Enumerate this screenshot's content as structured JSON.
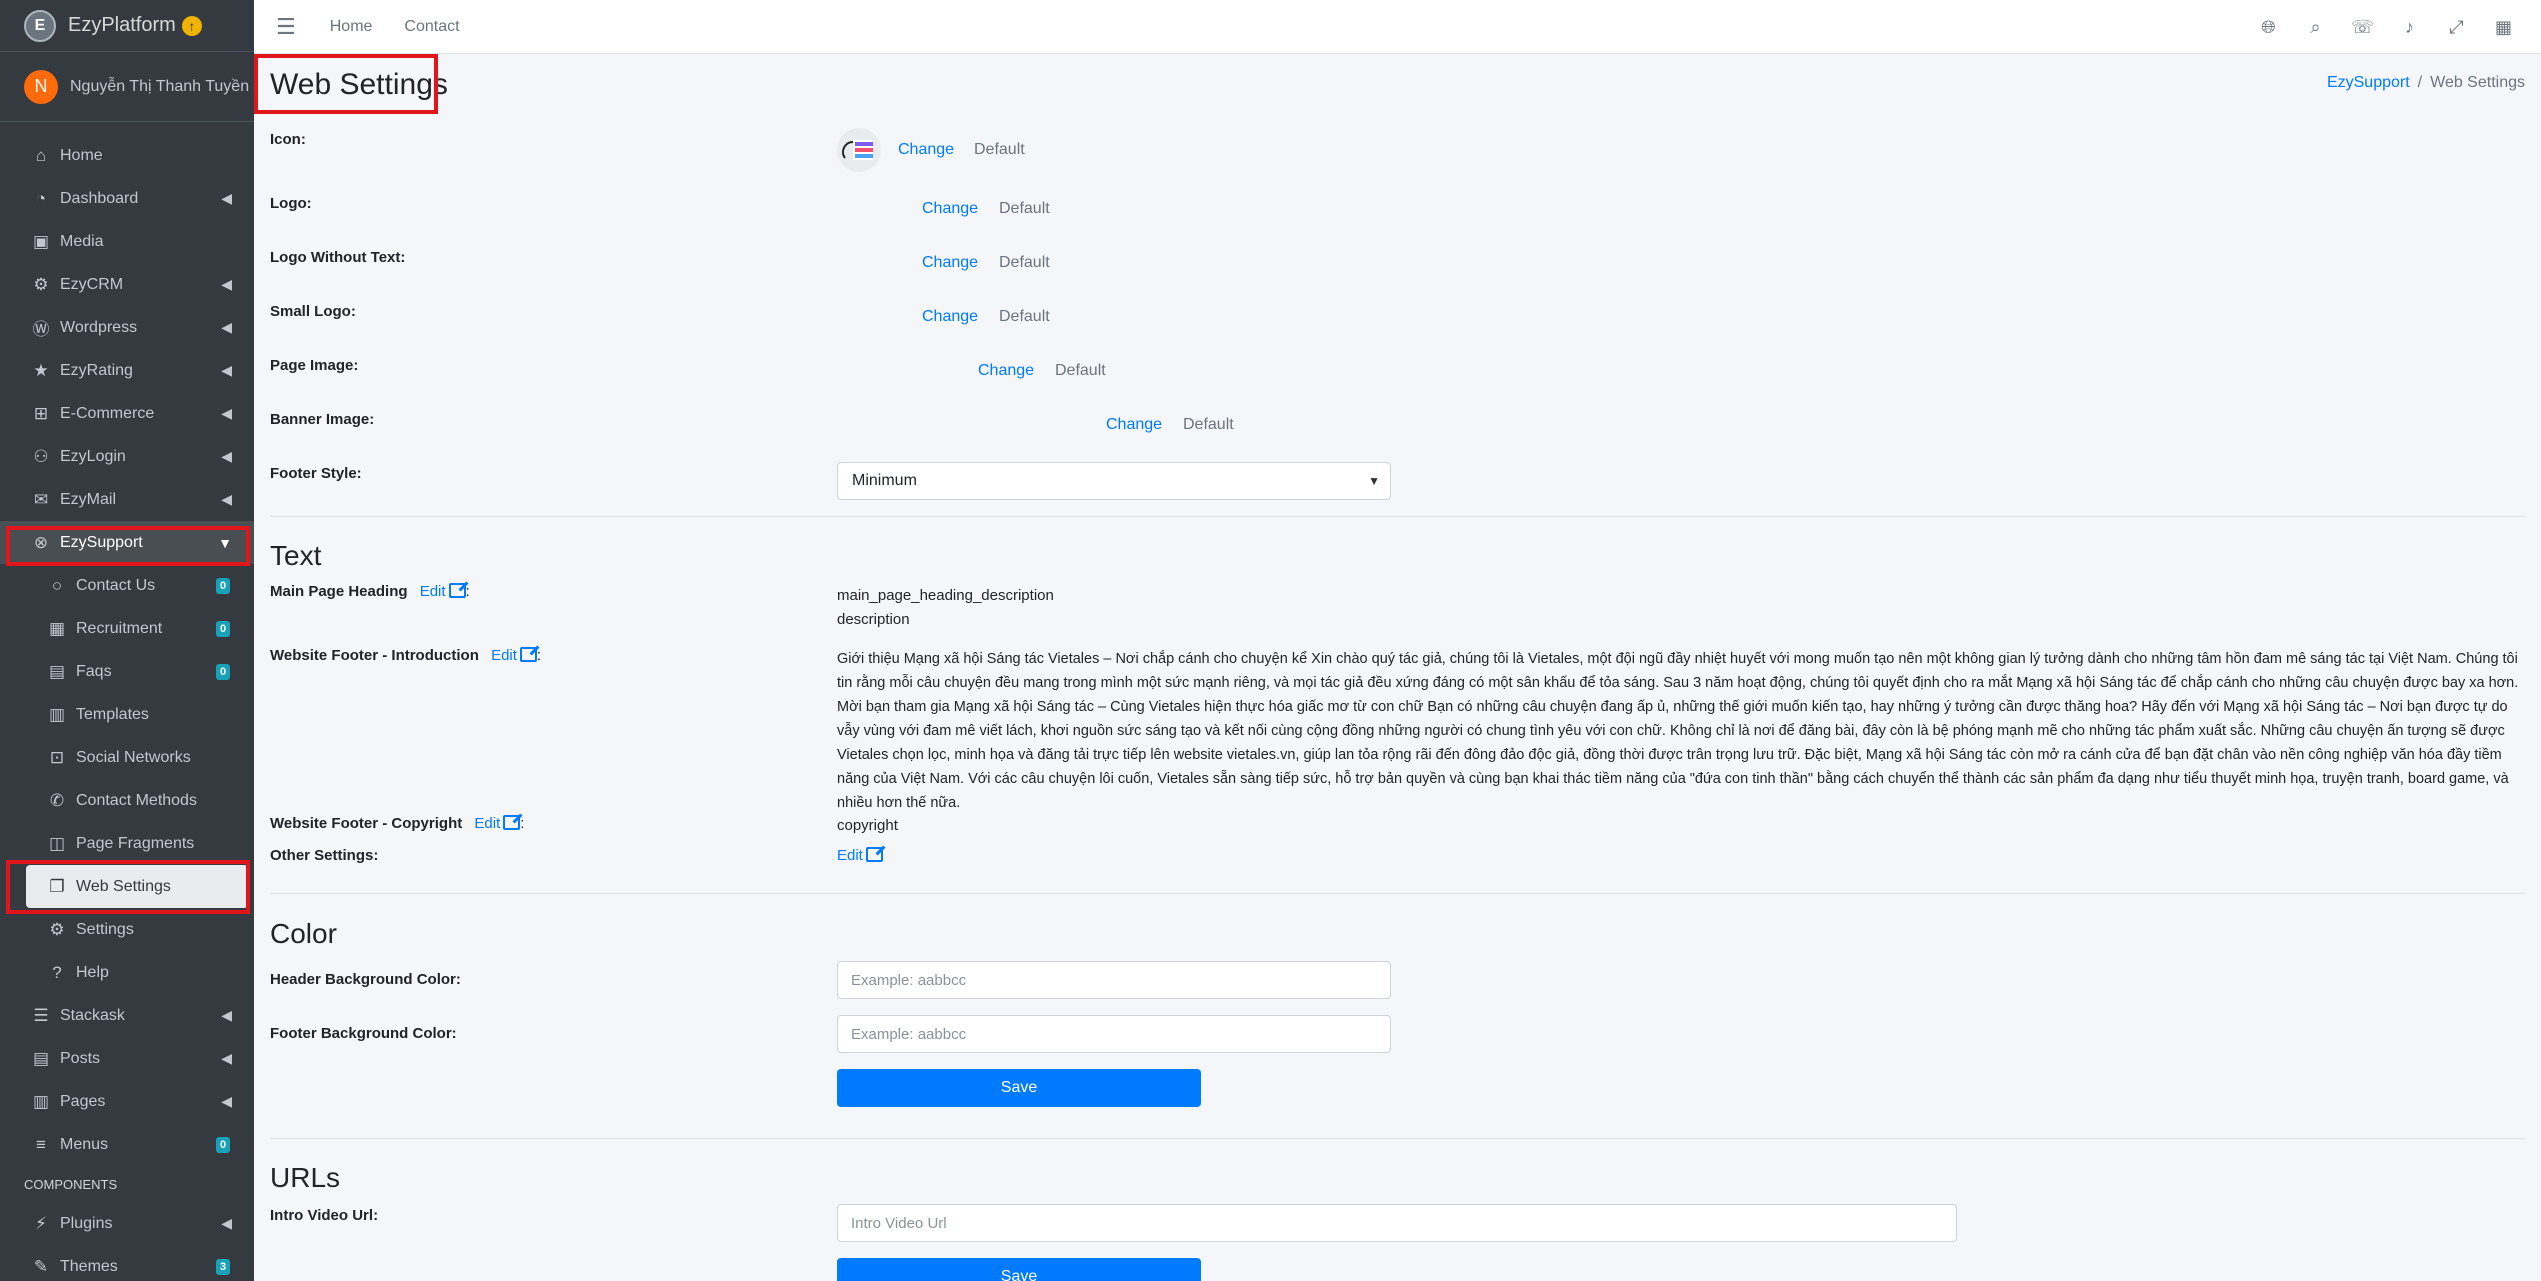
{
  "brand": {
    "name": "EzyPlatform",
    "logo_letter": "E",
    "badge_icon": "arrow-up-circle-icon"
  },
  "user": {
    "initial": "N",
    "name": "Nguyễn Thị Thanh Tuyền"
  },
  "sidebar": {
    "items": [
      {
        "label": "Home",
        "icon": "home-icon"
      },
      {
        "label": "Dashboard",
        "icon": "dashboard-icon"
      },
      {
        "label": "Media",
        "icon": "image-icon"
      },
      {
        "label": "EzyCRM",
        "icon": "crm-icon"
      },
      {
        "label": "Wordpress",
        "icon": "wordpress-icon"
      },
      {
        "label": "EzyRating",
        "icon": "star-icon"
      },
      {
        "label": "E-Commerce",
        "icon": "basket-icon"
      },
      {
        "label": "EzyLogin",
        "icon": "user-lock-icon"
      },
      {
        "label": "EzyMail",
        "icon": "mail-icon"
      },
      {
        "label": "EzySupport",
        "icon": "support-icon"
      }
    ],
    "sub_items": [
      {
        "label": "Contact Us",
        "badge": "0"
      },
      {
        "label": "Recruitment",
        "badge": "0"
      },
      {
        "label": "Faqs",
        "badge": "0"
      },
      {
        "label": "Templates"
      },
      {
        "label": "Social Networks"
      },
      {
        "label": "Contact Methods"
      },
      {
        "label": "Page Fragments"
      },
      {
        "label": "Web Settings"
      },
      {
        "label": "Settings"
      },
      {
        "label": "Help"
      }
    ],
    "more_items": [
      {
        "label": "Stackask"
      },
      {
        "label": "Posts"
      },
      {
        "label": "Pages"
      },
      {
        "label": "Menus",
        "badge": "0"
      }
    ],
    "components_header": "COMPONENTS",
    "component_items": [
      {
        "label": "Plugins"
      },
      {
        "label": "Themes",
        "badge": "3"
      }
    ]
  },
  "topbar": {
    "home": "Home",
    "contact": "Contact"
  },
  "page": {
    "title": "Web Settings",
    "breadcrumb": {
      "parent": "EzySupport",
      "sep": "/",
      "current": "Web Settings"
    }
  },
  "images": {
    "change": "Change",
    "default": "Default",
    "icon_label": "Icon:",
    "logo_label": "Logo:",
    "logo_no_text_label": "Logo Without Text:",
    "small_logo_label": "Small Logo:",
    "page_image_label": "Page Image:",
    "banner_image_label": "Banner Image:",
    "footer_style_label": "Footer Style:",
    "footer_style_value": "Minimum"
  },
  "text_section": {
    "title": "Text",
    "edit": "Edit",
    "colon": ":",
    "main_heading_label": "Main Page Heading",
    "main_heading_value": "main_page_heading_description",
    "main_heading_desc": "description",
    "footer_intro_label": "Website Footer - Introduction",
    "footer_intro_value": "Giới thiệu Mạng xã hội Sáng tác Vietales – Nơi chắp cánh cho chuyện kể Xin chào quý tác giả, chúng tôi là Vietales, một đội ngũ đầy nhiệt huyết với mong muốn tạo nên một không gian lý tưởng dành cho những tâm hồn đam mê sáng tác tại Việt Nam. Chúng tôi tin rằng mỗi câu chuyện đều mang trong mình một sức mạnh riêng, và mọi tác giả đều xứng đáng có một sân khấu để tỏa sáng. Sau 3 năm hoạt động, chúng tôi quyết định cho ra mắt Mạng xã hội Sáng tác để chắp cánh cho những câu chuyện được bay xa hơn. Mời bạn tham gia Mạng xã hội Sáng tác – Cùng Vietales hiện thực hóa giấc mơ từ con chữ Bạn có những câu chuyện đang ấp ủ, những thế giới muốn kiến tạo, hay những ý tưởng cần được thăng hoa? Hãy đến với Mạng xã hội Sáng tác – Nơi bạn được tự do vẫy vùng với đam mê viết lách, khơi nguồn sức sáng tạo và kết nối cùng cộng đồng những người có chung tình yêu với con chữ. Không chỉ là nơi để đăng bài, đây còn là bệ phóng mạnh mẽ cho những tác phẩm xuất sắc. Những câu chuyện ấn tượng sẽ được Vietales chọn lọc, minh họa và đăng tải trực tiếp lên website vietales.vn, giúp lan tỏa rộng rãi đến đông đảo độc giả, đồng thời được trân trọng lưu trữ. Đặc biệt, Mạng xã hội Sáng tác còn mở ra cánh cửa để bạn đặt chân vào nền công nghiệp văn hóa đầy tiềm năng của Việt Nam. Với các câu chuyện lôi cuốn, Vietales sẵn sàng tiếp sức, hỗ trợ bản quyền và cùng bạn khai thác tiềm năng của \"đứa con tinh thần\" bằng cách chuyển thể thành các sản phẩm đa dạng như tiểu thuyết minh họa, truyện tranh, board game, và nhiều hơn thế nữa.",
    "footer_copyright_label": "Website Footer - Copyright",
    "footer_copyright_value": "copyright",
    "other_settings_label": "Other Settings:"
  },
  "color_section": {
    "title": "Color",
    "header_bg_label": "Header Background Color:",
    "footer_bg_label": "Footer Background Color:",
    "placeholder": "Example: aabbcc",
    "save": "Save"
  },
  "urls_section": {
    "title": "URLs",
    "intro_video_label": "Intro Video Url:",
    "intro_video_placeholder": "Intro Video Url",
    "save": "Save"
  },
  "colors": {
    "accent": "#007bff",
    "sidebar_bg": "#343a40",
    "highlight": "#e0161b",
    "badge": "#17a2b8"
  }
}
